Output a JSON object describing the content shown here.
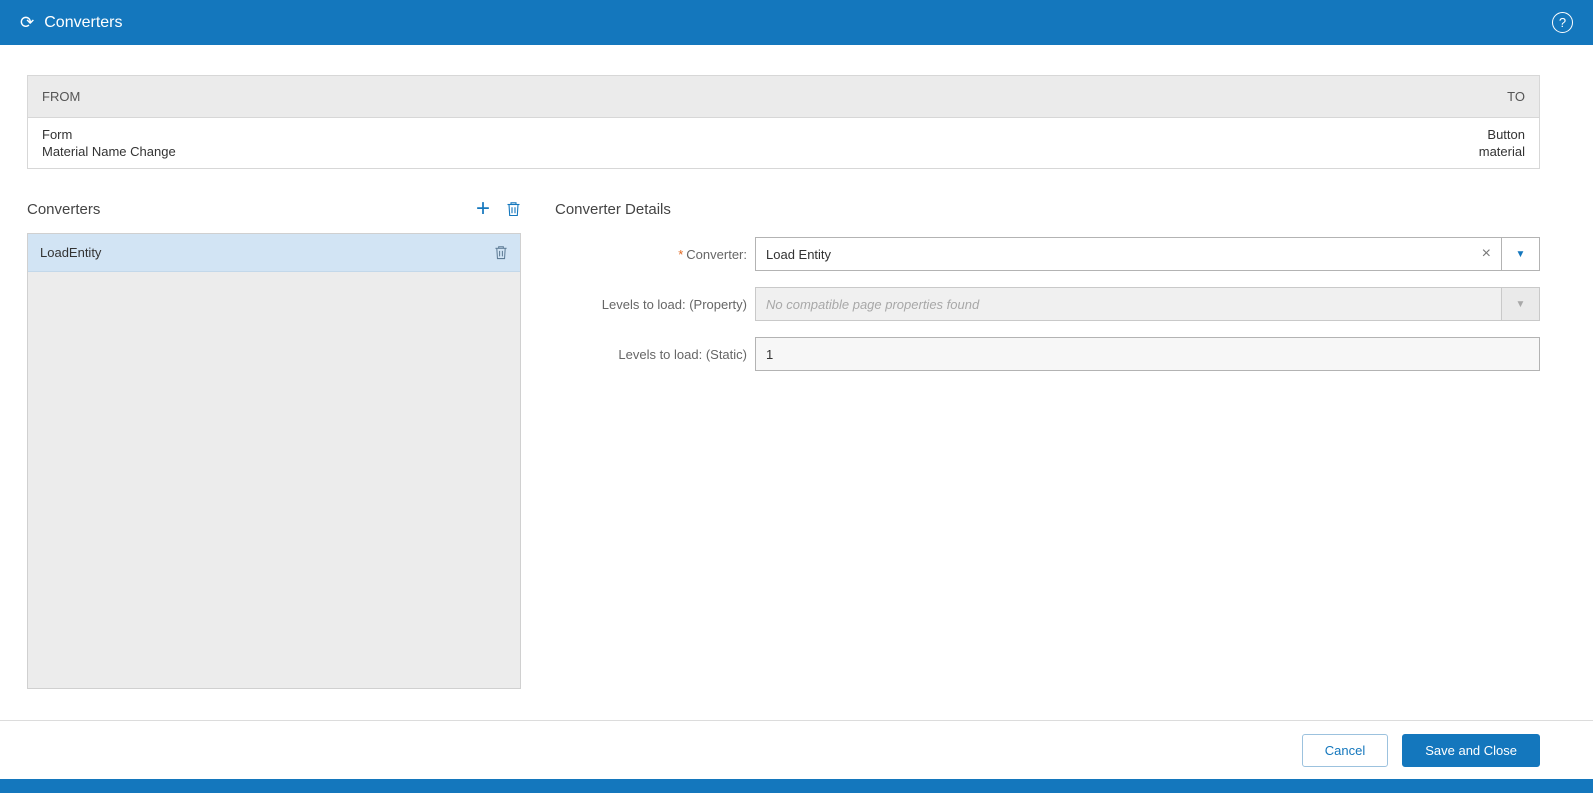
{
  "header": {
    "title": "Converters"
  },
  "icons": {
    "converter": "⟳",
    "help": "?",
    "add": "+",
    "clear": "×",
    "caret": "▼"
  },
  "mapping_table": {
    "from_header": "FROM",
    "to_header": "TO",
    "row": {
      "from_type": "Form",
      "from_name": "Material Name Change",
      "to_type": "Button",
      "to_name": "material"
    }
  },
  "converters_panel": {
    "title": "Converters",
    "items": [
      {
        "label": "LoadEntity",
        "selected": true
      }
    ]
  },
  "details_panel": {
    "title": "Converter Details",
    "fields": [
      {
        "label": "Converter:",
        "required_mark": "*",
        "value": "Load Entity",
        "type": "combobox"
      },
      {
        "label": "Levels to load: (Property)",
        "placeholder": "No compatible page properties found",
        "disabled": true,
        "type": "combobox"
      },
      {
        "label": "Levels to load: (Static)",
        "value": "1",
        "type": "text"
      }
    ]
  },
  "footer": {
    "cancel_label": "Cancel",
    "save_label": "Save and Close"
  },
  "colors": {
    "primary_blue": "#1477bd",
    "selected_row": "#d2e4f4",
    "required_mark": "#e0661f",
    "table_header_bg": "#ebebeb",
    "list_bg": "#ececec"
  }
}
